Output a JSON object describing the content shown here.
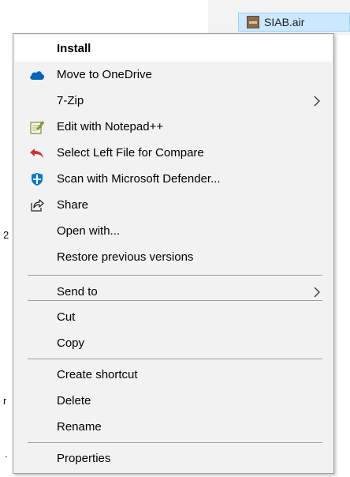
{
  "explorer": {
    "selected_file": "SIAB.air",
    "fragments": [
      "2",
      "r",
      "."
    ]
  },
  "menu": {
    "items": [
      {
        "label": "Install",
        "icon": "",
        "bold": true
      },
      {
        "label": "Move to OneDrive",
        "icon": "onedrive-icon"
      },
      {
        "label": "7-Zip",
        "icon": "",
        "submenu": true
      },
      {
        "label": "Edit with Notepad++",
        "icon": "notepad-plus-plus-icon"
      },
      {
        "label": "Select Left File for Compare",
        "icon": "compare-icon"
      },
      {
        "label": "Scan with Microsoft Defender...",
        "icon": "defender-icon"
      },
      {
        "label": "Share",
        "icon": "share-icon"
      },
      {
        "label": "Open with...",
        "icon": ""
      },
      {
        "label": "Restore previous versions",
        "icon": ""
      },
      {
        "label": "Send to",
        "icon": "",
        "submenu": true
      },
      {
        "label": "Cut",
        "icon": ""
      },
      {
        "label": "Copy",
        "icon": ""
      },
      {
        "label": "Create shortcut",
        "icon": ""
      },
      {
        "label": "Delete",
        "icon": ""
      },
      {
        "label": "Rename",
        "icon": ""
      },
      {
        "label": "Properties",
        "icon": ""
      }
    ]
  },
  "colors": {
    "menu_bg": "#f2f2f2",
    "menu_border": "#a0a0a0",
    "hover_bg": "#ffffff",
    "selection_bg": "#cce8ff",
    "onedrive_blue": "#0364b8",
    "defender_blue": "#0078d4",
    "compare_red": "#d32f2f"
  }
}
